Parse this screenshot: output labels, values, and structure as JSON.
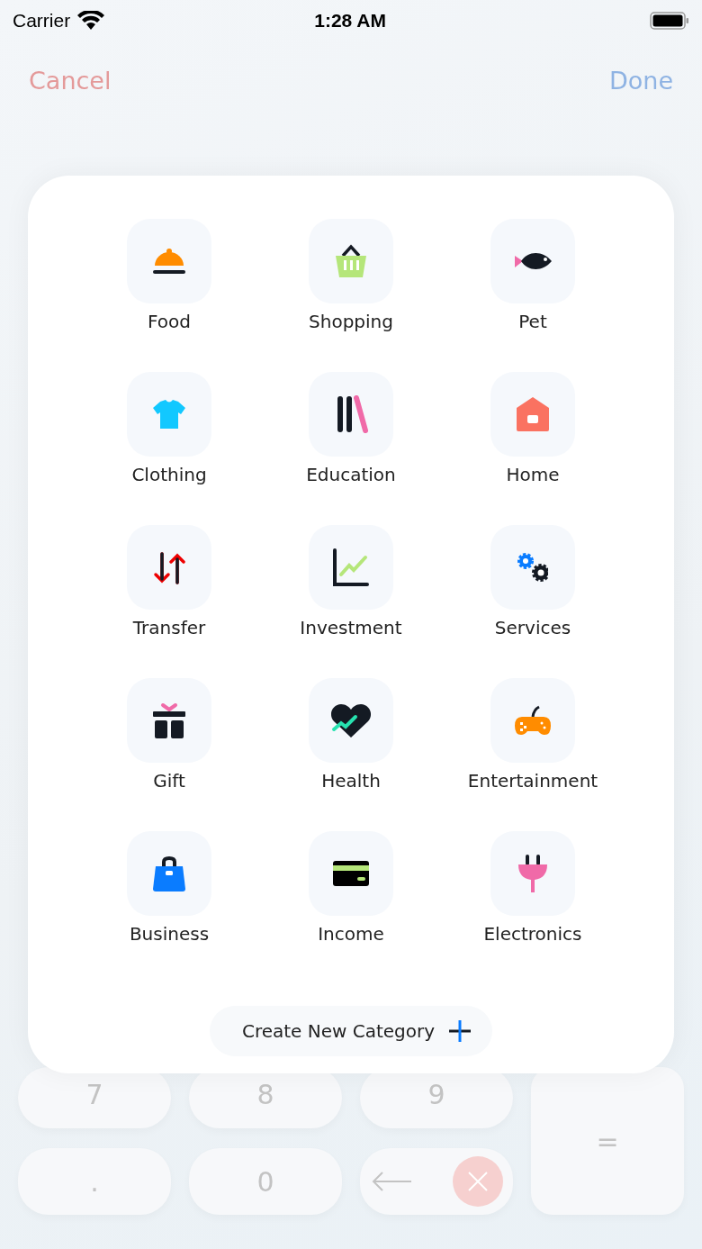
{
  "status_bar": {
    "carrier": "Carrier",
    "time": "1:28 AM"
  },
  "nav": {
    "cancel": "Cancel",
    "done": "Done"
  },
  "categories": [
    {
      "label": "Food"
    },
    {
      "label": "Shopping"
    },
    {
      "label": "Pet"
    },
    {
      "label": "Clothing"
    },
    {
      "label": "Education"
    },
    {
      "label": "Home"
    },
    {
      "label": "Transfer"
    },
    {
      "label": "Investment"
    },
    {
      "label": "Services"
    },
    {
      "label": "Gift"
    },
    {
      "label": "Health"
    },
    {
      "label": "Entertainment"
    },
    {
      "label": "Business"
    },
    {
      "label": "Income"
    },
    {
      "label": "Electronics"
    }
  ],
  "create_button": {
    "label": "Create New Category"
  },
  "keypad": {
    "keys": [
      "7",
      "8",
      "9",
      "=",
      ".",
      "0"
    ]
  }
}
